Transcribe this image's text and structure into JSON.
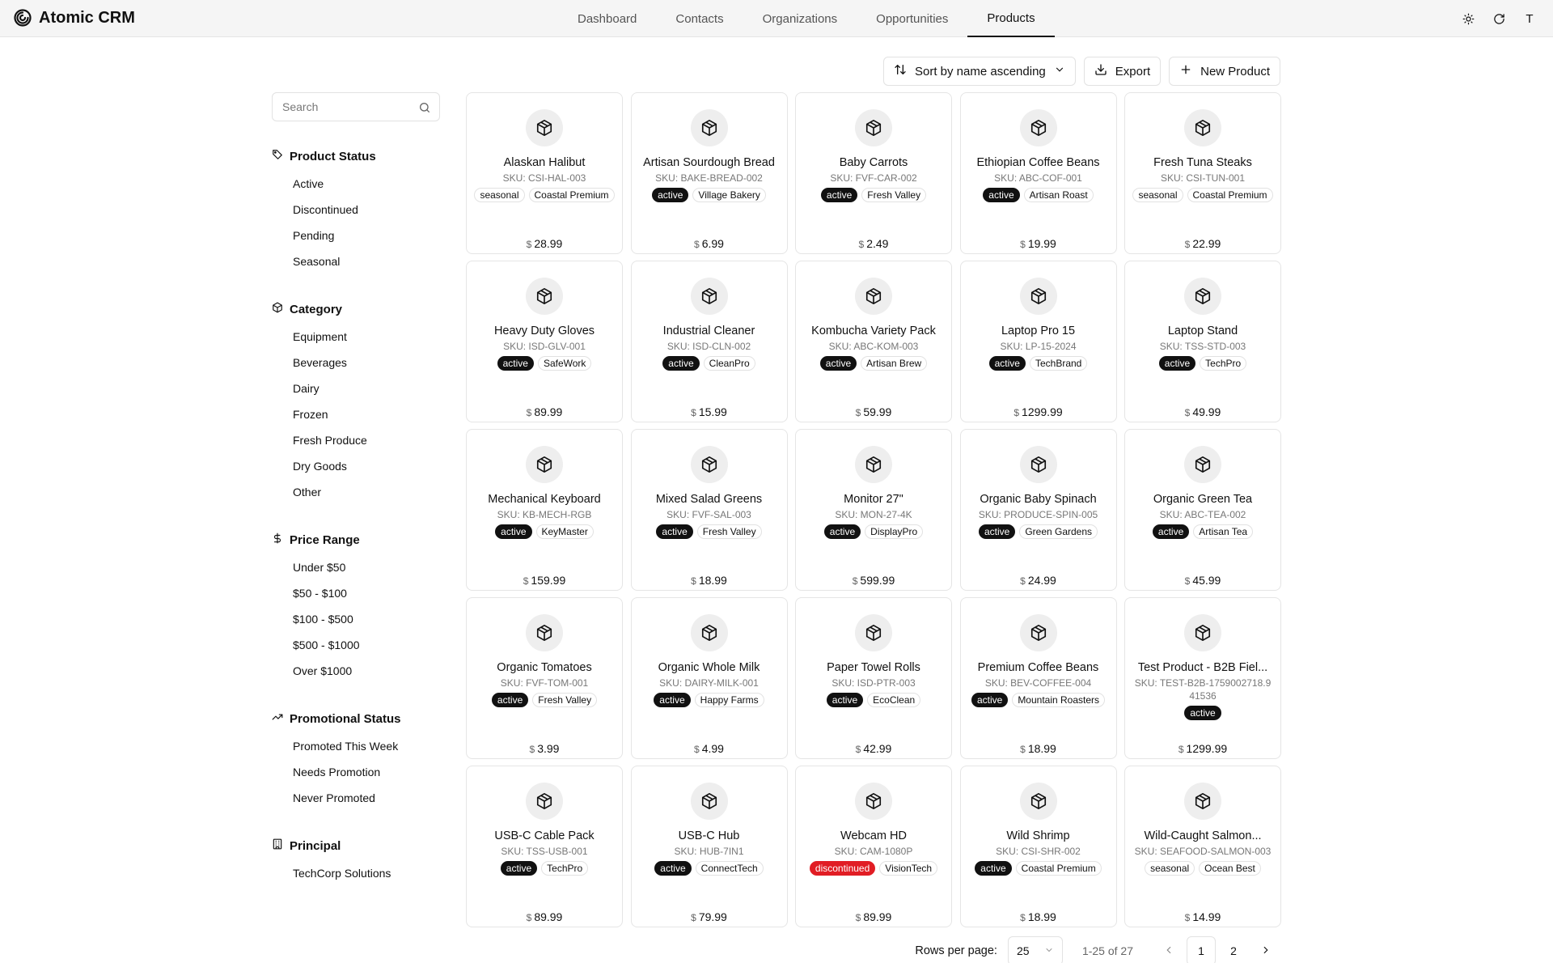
{
  "app": {
    "title": "Atomic CRM"
  },
  "nav": {
    "items": [
      {
        "label": "Dashboard"
      },
      {
        "label": "Contacts"
      },
      {
        "label": "Organizations"
      },
      {
        "label": "Opportunities"
      },
      {
        "label": "Products",
        "active": true
      }
    ]
  },
  "header": {
    "icons": [
      "sun-icon",
      "refresh-icon"
    ],
    "user_initial": "T"
  },
  "toolbar": {
    "sort_label": "Sort by name ascending",
    "export_label": "Export",
    "new_label": "New Product"
  },
  "search": {
    "placeholder": "Search"
  },
  "filters": [
    {
      "title": "Product Status",
      "icon": "tag-icon",
      "items": [
        "Active",
        "Discontinued",
        "Pending",
        "Seasonal"
      ]
    },
    {
      "title": "Category",
      "icon": "box-icon",
      "items": [
        "Equipment",
        "Beverages",
        "Dairy",
        "Frozen",
        "Fresh Produce",
        "Dry Goods",
        "Other"
      ]
    },
    {
      "title": "Price Range",
      "icon": "dollar-icon",
      "items": [
        "Under $50",
        "$50 - $100",
        "$100 - $500",
        "$500 - $1000",
        "Over $1000"
      ]
    },
    {
      "title": "Promotional Status",
      "icon": "trending-up-icon",
      "items": [
        "Promoted This Week",
        "Needs Promotion",
        "Never Promoted"
      ]
    },
    {
      "title": "Principal",
      "icon": "building-icon",
      "items": [
        "TechCorp Solutions"
      ]
    }
  ],
  "currency_symbol": "$",
  "products": [
    {
      "name": "Alaskan Halibut",
      "sku": "SKU: CSI-HAL-003",
      "status": "seasonal",
      "principal": "Coastal Premium",
      "price": "$28.99"
    },
    {
      "name": "Artisan Sourdough Bread",
      "sku": "SKU: BAKE-BREAD-002",
      "status": "active",
      "principal": "Village Bakery",
      "price": "$6.99"
    },
    {
      "name": "Baby Carrots",
      "sku": "SKU: FVF-CAR-002",
      "status": "active",
      "principal": "Fresh Valley",
      "price": "$2.49"
    },
    {
      "name": "Ethiopian Coffee Beans",
      "sku": "SKU: ABC-COF-001",
      "status": "active",
      "principal": "Artisan Roast",
      "price": "$19.99"
    },
    {
      "name": "Fresh Tuna Steaks",
      "sku": "SKU: CSI-TUN-001",
      "status": "seasonal",
      "principal": "Coastal Premium",
      "price": "$22.99"
    },
    {
      "name": "Heavy Duty Gloves",
      "sku": "SKU: ISD-GLV-001",
      "status": "active",
      "principal": "SafeWork",
      "price": "$89.99"
    },
    {
      "name": "Industrial Cleaner",
      "sku": "SKU: ISD-CLN-002",
      "status": "active",
      "principal": "CleanPro",
      "price": "$15.99"
    },
    {
      "name": "Kombucha Variety Pack",
      "sku": "SKU: ABC-KOM-003",
      "status": "active",
      "principal": "Artisan Brew",
      "price": "$59.99"
    },
    {
      "name": "Laptop Pro 15",
      "sku": "SKU: LP-15-2024",
      "status": "active",
      "principal": "TechBrand",
      "price": "$1299.99"
    },
    {
      "name": "Laptop Stand",
      "sku": "SKU: TSS-STD-003",
      "status": "active",
      "principal": "TechPro",
      "price": "$49.99"
    },
    {
      "name": "Mechanical Keyboard",
      "sku": "SKU: KB-MECH-RGB",
      "status": "active",
      "principal": "KeyMaster",
      "price": "$159.99"
    },
    {
      "name": "Mixed Salad Greens",
      "sku": "SKU: FVF-SAL-003",
      "status": "active",
      "principal": "Fresh Valley",
      "price": "$18.99"
    },
    {
      "name": "Monitor 27\"",
      "sku": "SKU: MON-27-4K",
      "status": "active",
      "principal": "DisplayPro",
      "price": "$599.99"
    },
    {
      "name": "Organic Baby Spinach",
      "sku": "SKU: PRODUCE-SPIN-005",
      "status": "active",
      "principal": "Green Gardens",
      "price": "$24.99"
    },
    {
      "name": "Organic Green Tea",
      "sku": "SKU: ABC-TEA-002",
      "status": "active",
      "principal": "Artisan Tea",
      "price": "$45.99"
    },
    {
      "name": "Organic Tomatoes",
      "sku": "SKU: FVF-TOM-001",
      "status": "active",
      "principal": "Fresh Valley",
      "price": "$3.99"
    },
    {
      "name": "Organic Whole Milk",
      "sku": "SKU: DAIRY-MILK-001",
      "status": "active",
      "principal": "Happy Farms",
      "price": "$4.99"
    },
    {
      "name": "Paper Towel Rolls",
      "sku": "SKU: ISD-PTR-003",
      "status": "active",
      "principal": "EcoClean",
      "price": "$42.99"
    },
    {
      "name": "Premium Coffee Beans",
      "sku": "SKU: BEV-COFFEE-004",
      "status": "active",
      "principal": "Mountain Roasters",
      "price": "$18.99"
    },
    {
      "name": "Test Product - B2B Fiel...",
      "sku": "SKU: TEST-B2B-1759002718.941536",
      "status": "active",
      "principal": "",
      "price": "$1299.99"
    },
    {
      "name": "USB-C Cable Pack",
      "sku": "SKU: TSS-USB-001",
      "status": "active",
      "principal": "TechPro",
      "price": "$89.99"
    },
    {
      "name": "USB-C Hub",
      "sku": "SKU: HUB-7IN1",
      "status": "active",
      "principal": "ConnectTech",
      "price": "$79.99"
    },
    {
      "name": "Webcam HD",
      "sku": "SKU: CAM-1080P",
      "status": "discontinued",
      "principal": "VisionTech",
      "price": "$89.99"
    },
    {
      "name": "Wild Shrimp",
      "sku": "SKU: CSI-SHR-002",
      "status": "active",
      "principal": "Coastal Premium",
      "price": "$18.99"
    },
    {
      "name": "Wild-Caught Salmon...",
      "sku": "SKU: SEAFOOD-SALMON-003",
      "status": "seasonal",
      "principal": "Ocean Best",
      "price": "$14.99"
    }
  ],
  "pagination": {
    "rows_label": "Rows per page:",
    "rows_value": "25",
    "range": "1-25 of 27",
    "pages": [
      "1",
      "2"
    ],
    "current_page": "1"
  },
  "colors": {
    "active_badge": "#111111",
    "discontinued_badge": "#e11d24"
  }
}
